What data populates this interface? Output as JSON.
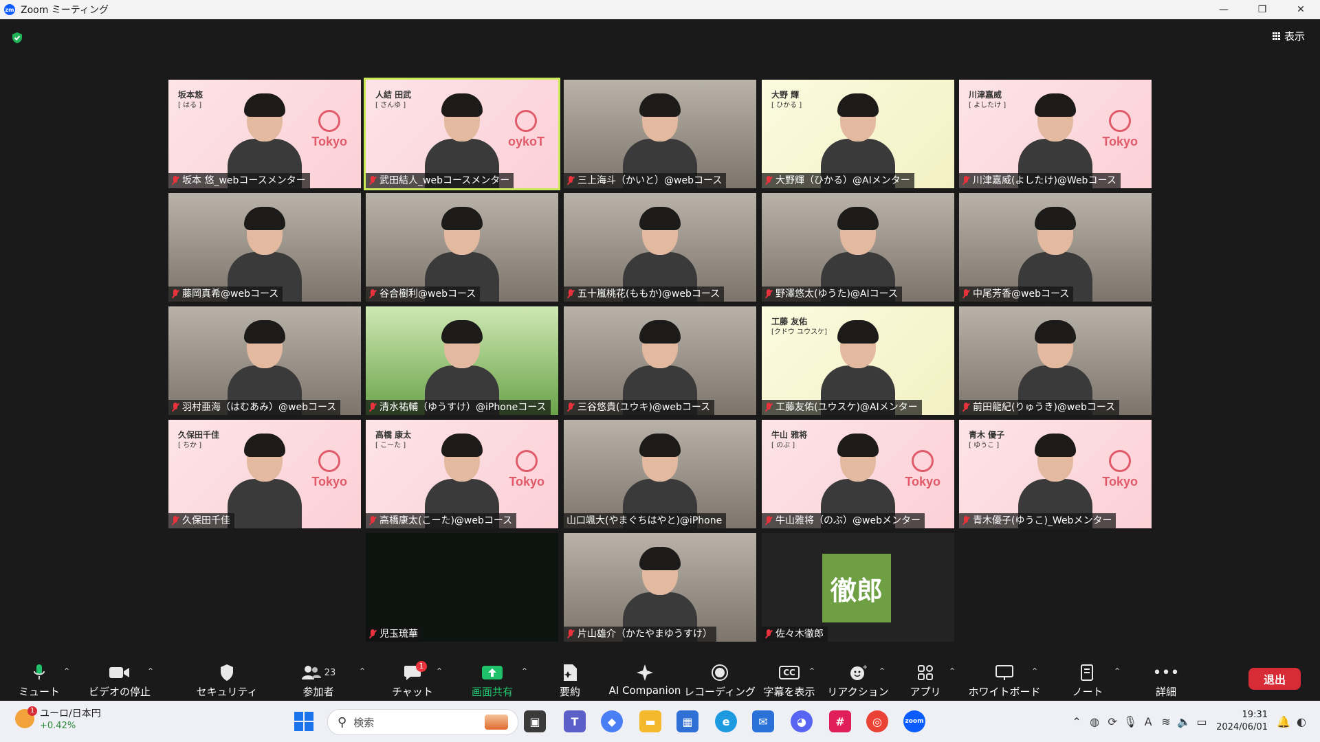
{
  "window": {
    "title": "Zoom ミーティング",
    "logo_text": "zm"
  },
  "controls": {
    "minimize": "—",
    "restore": "❐",
    "close": "✕"
  },
  "view": {
    "label": "表示"
  },
  "participants": [
    {
      "name": "坂本 悠_webコースメンター",
      "bg": "pink",
      "bgname": "坂本悠",
      "bgsub": "[ はる ]",
      "brand": "Tokyo"
    },
    {
      "name": "武田結人_webコースメンター",
      "bg": "pink",
      "bgname": "人結 田武",
      "bgsub": "[ さんゆ ]",
      "brand": "oykoT",
      "active": true
    },
    {
      "name": "三上海斗（かいと）@webコース",
      "bg": "room"
    },
    {
      "name": "大野輝（ひかる）@AIメンター",
      "bg": "yellow",
      "bgname": "大野 輝",
      "bgsub": "[ ひかる ]"
    },
    {
      "name": "川津嘉威(よしたけ)@Webコース",
      "bg": "pink",
      "bgname": "川津嘉威",
      "bgsub": "[ よしたけ ]",
      "brand": "Tokyo"
    },
    {
      "name": "藤岡真希@webコース",
      "bg": "room"
    },
    {
      "name": "谷合樹利@webコース",
      "bg": "room"
    },
    {
      "name": "五十嵐桃花(ももか)@webコース",
      "bg": "room"
    },
    {
      "name": "野澤悠太(ゆうた)@AIコース",
      "bg": "room"
    },
    {
      "name": "中尾芳香@webコース",
      "bg": "room"
    },
    {
      "name": "羽村亜海（はむあみ）@webコース",
      "bg": "room"
    },
    {
      "name": "清水祐輔（ゆうすけ）@iPhoneコース",
      "bg": "green"
    },
    {
      "name": "三谷悠貴(ユウキ)@webコース",
      "bg": "room"
    },
    {
      "name": "工藤友佑(ユウスケ)@AIメンター",
      "bg": "yellow",
      "bgname": "工藤 友佑",
      "bgsub": "[クドウ ユウスケ]"
    },
    {
      "name": "前田龍紀(りゅうき)@webコース",
      "bg": "room"
    },
    {
      "name": "久保田千佳",
      "bg": "pink",
      "bgname": "久保田千佳",
      "bgsub": "[ ちか ]",
      "brand": "Tokyo"
    },
    {
      "name": "高橋康太(こーた)@webコース",
      "bg": "pink",
      "bgname": "高橋 康太",
      "bgsub": "[ こーた ]",
      "brand": "Tokyo"
    },
    {
      "name": "山口颯大(やまぐちはやと)@iPhone",
      "bg": "room",
      "mic_on": true
    },
    {
      "name": "牛山雅将（のぶ）@webメンター",
      "bg": "pink",
      "bgname": "牛山 雅将",
      "bgsub": "[ のぶ ]",
      "brand": "Tokyo"
    },
    {
      "name": "青木優子(ゆうこ)_Webメンター",
      "bg": "pink",
      "bgname": "青木 優子",
      "bgsub": "[ ゆうこ ]",
      "brand": "Tokyo"
    },
    {
      "name": "児玉琉華",
      "bg": "dark"
    },
    {
      "name": "片山雄介（かたやまゆうすけ）",
      "bg": "room"
    },
    {
      "name": "佐々木徹郎",
      "bg": "avatar",
      "initials": "徹郎"
    }
  ],
  "toolbar": {
    "mute": "ミュート",
    "video": "ビデオの停止",
    "security": "セキュリティ",
    "participants": "参加者",
    "participants_count": "23",
    "chat": "チャット",
    "chat_badge": "1",
    "share": "画面共有",
    "summary": "要約",
    "ai": "AI Companion",
    "record": "レコーディング",
    "captions": "字幕を表示",
    "captions_icon": "CC",
    "reactions": "リアクション",
    "apps": "アプリ",
    "whiteboard": "ホワイトボード",
    "notes": "ノート",
    "more": "詳細",
    "leave": "退出"
  },
  "taskbar": {
    "weather_title": "ユーロ/日本円",
    "weather_sub": "+0.42%",
    "weather_badge": "1",
    "search_placeholder": "検索",
    "time": "19:31",
    "date": "2024/06/01",
    "zoom_label": "zoom"
  },
  "colors": {
    "accent_green": "#1fc26a",
    "leave_red": "#d72b35",
    "active_border": "#c9e85a",
    "mic_muted": "#e8323c"
  }
}
